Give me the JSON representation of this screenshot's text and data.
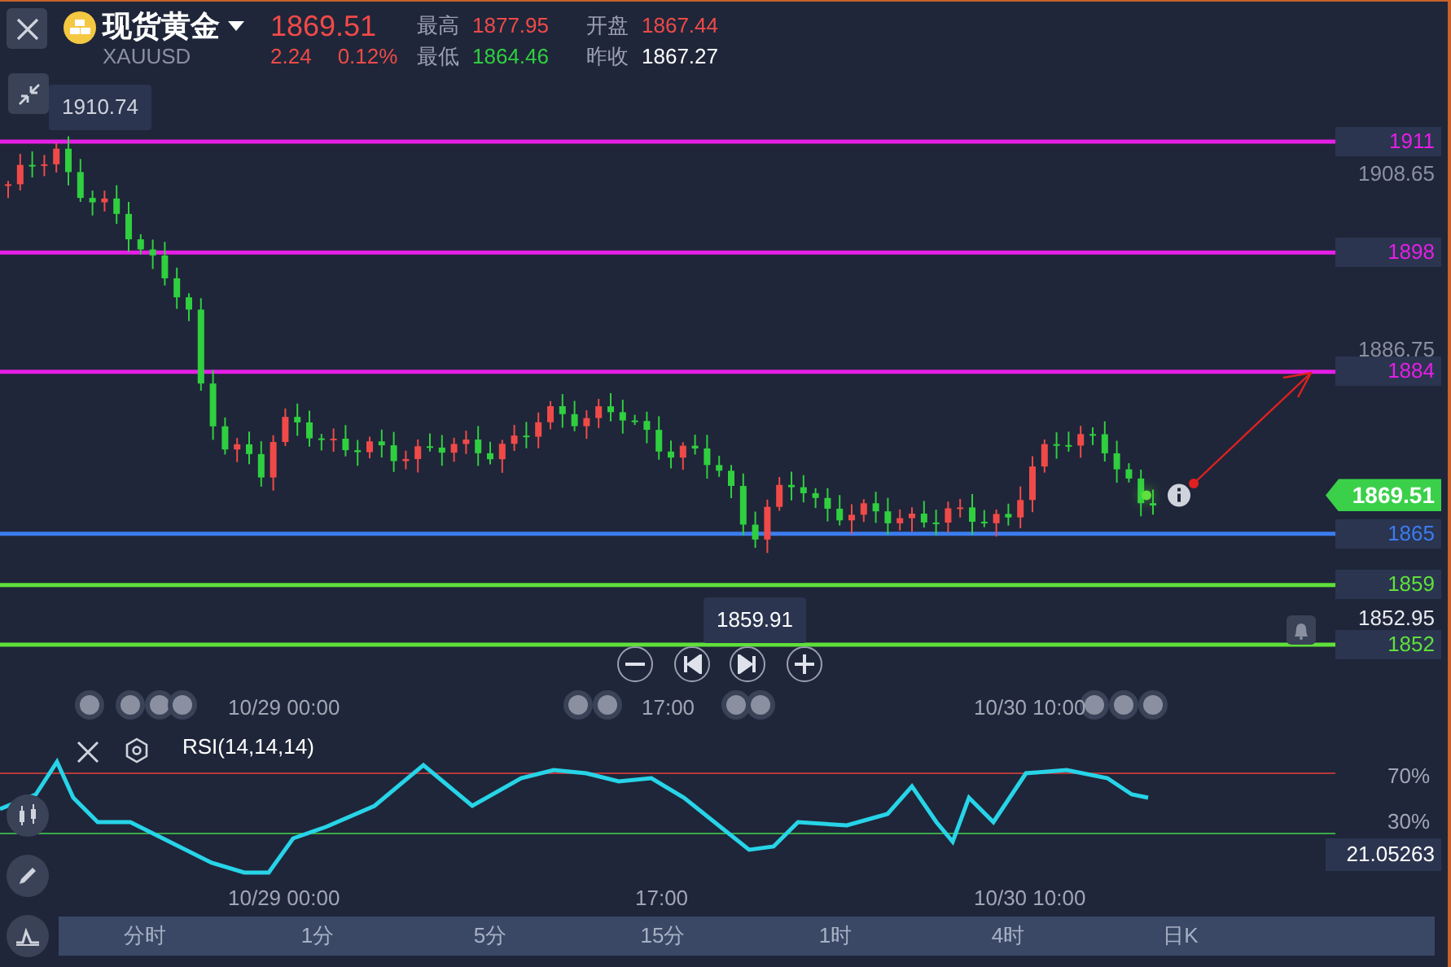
{
  "header": {
    "symbol_name": "现货黄金",
    "symbol_code": "XAUUSD",
    "price": "1869.51",
    "change": "2.24",
    "change_percent": "0.12%",
    "stats": [
      {
        "label": "最高",
        "value": "1877.95",
        "color": "#f04a48"
      },
      {
        "label": "开盘",
        "value": "1867.44",
        "color": "#f04a48"
      },
      {
        "label": "最低",
        "value": "1864.46",
        "color": "#2fcf3f"
      },
      {
        "label": "昨收",
        "value": "1867.27",
        "color": "#ffffff"
      }
    ]
  },
  "chart": {
    "high_marker": "1910.74",
    "price_labels": [
      "1908.65",
      "1886.75",
      "1852.95"
    ],
    "levels": [
      {
        "value": "1911",
        "color": "#e61ee6"
      },
      {
        "value": "1898",
        "color": "#e61ee6"
      },
      {
        "value": "1884",
        "color": "#e61ee6"
      },
      {
        "value": "1865",
        "color": "#3b7cf0"
      },
      {
        "value": "1859",
        "color": "#5fe03a"
      },
      {
        "value": "1852",
        "color": "#5fe03a"
      }
    ],
    "current_price": "1869.51",
    "crosshair_tooltip": "1859.91",
    "time_labels": [
      "10/29 00:00",
      "17:00",
      "10/30 10:00"
    ]
  },
  "rsi": {
    "title": "RSI(14,14,14)",
    "upper_band": "70%",
    "lower_band": "30%",
    "current_value": "21.05263",
    "time_labels": [
      "10/29 00:00",
      "17:00",
      "10/30 10:00"
    ]
  },
  "timeframes": [
    {
      "label": "分时",
      "selected": false
    },
    {
      "label": "1分",
      "selected": false
    },
    {
      "label": "5分",
      "selected": false
    },
    {
      "label": "15分",
      "selected": false
    },
    {
      "label": "1时",
      "selected": false
    },
    {
      "label": "4时",
      "selected": false
    },
    {
      "label": "日K",
      "selected": false
    }
  ]
}
